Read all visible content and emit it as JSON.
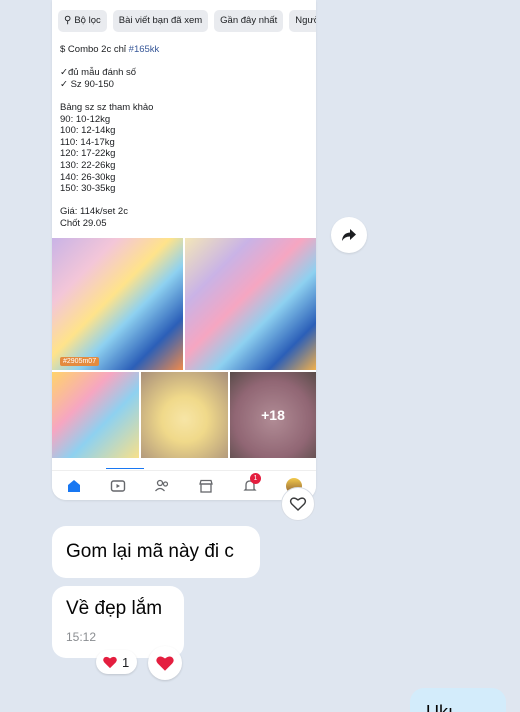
{
  "screenshot": {
    "filter_chips": [
      {
        "label": "Bộ lọc",
        "icon": "filter-icon"
      },
      {
        "label": "Bài viết bạn đã xem"
      },
      {
        "label": "Gần đây nhất"
      },
      {
        "label": "Người đ"
      }
    ],
    "post_lines": [
      {
        "prefix": "$ Combo 2c chỉ ",
        "tag": "#165kk"
      },
      {
        "prefix": ""
      },
      {
        "prefix": "✓đủ mẫu đánh số"
      },
      {
        "prefix": "✓ Sz 90-150"
      },
      {
        "prefix": ""
      },
      {
        "prefix": "Bảng sz sz tham khảo"
      },
      {
        "prefix": "90: 10-12kg"
      },
      {
        "prefix": "100: 12-14kg"
      },
      {
        "prefix": "110: 14-17kg"
      },
      {
        "prefix": "120: 17-22kg"
      },
      {
        "prefix": "130: 22-26kg"
      },
      {
        "prefix": "140: 26-30kg"
      },
      {
        "prefix": "150: 30-35kg"
      },
      {
        "prefix": ""
      },
      {
        "prefix": "Giá: 114k/set 2c"
      },
      {
        "prefix": "Chốt 29.05"
      }
    ],
    "photo_label": "#2905m07",
    "more_photos": "+18",
    "tabs": [
      {
        "icon": "home-icon"
      },
      {
        "icon": "video-icon"
      },
      {
        "icon": "friends-icon"
      },
      {
        "icon": "marketplace-icon"
      },
      {
        "icon": "bell-icon",
        "badge": "1"
      },
      {
        "icon": "profile-avatar"
      }
    ]
  },
  "messages": [
    {
      "text": "Gom lại mã này đi c"
    },
    {
      "text": "Về đẹp lắm",
      "time": "15:12",
      "reaction_count": "1"
    }
  ],
  "sent_message_partial": "Ukı",
  "colors": {
    "background": "#dfe6f0",
    "heart": "#e41e3f",
    "link": "#385898",
    "sent_bubble": "#d3ecfb"
  }
}
